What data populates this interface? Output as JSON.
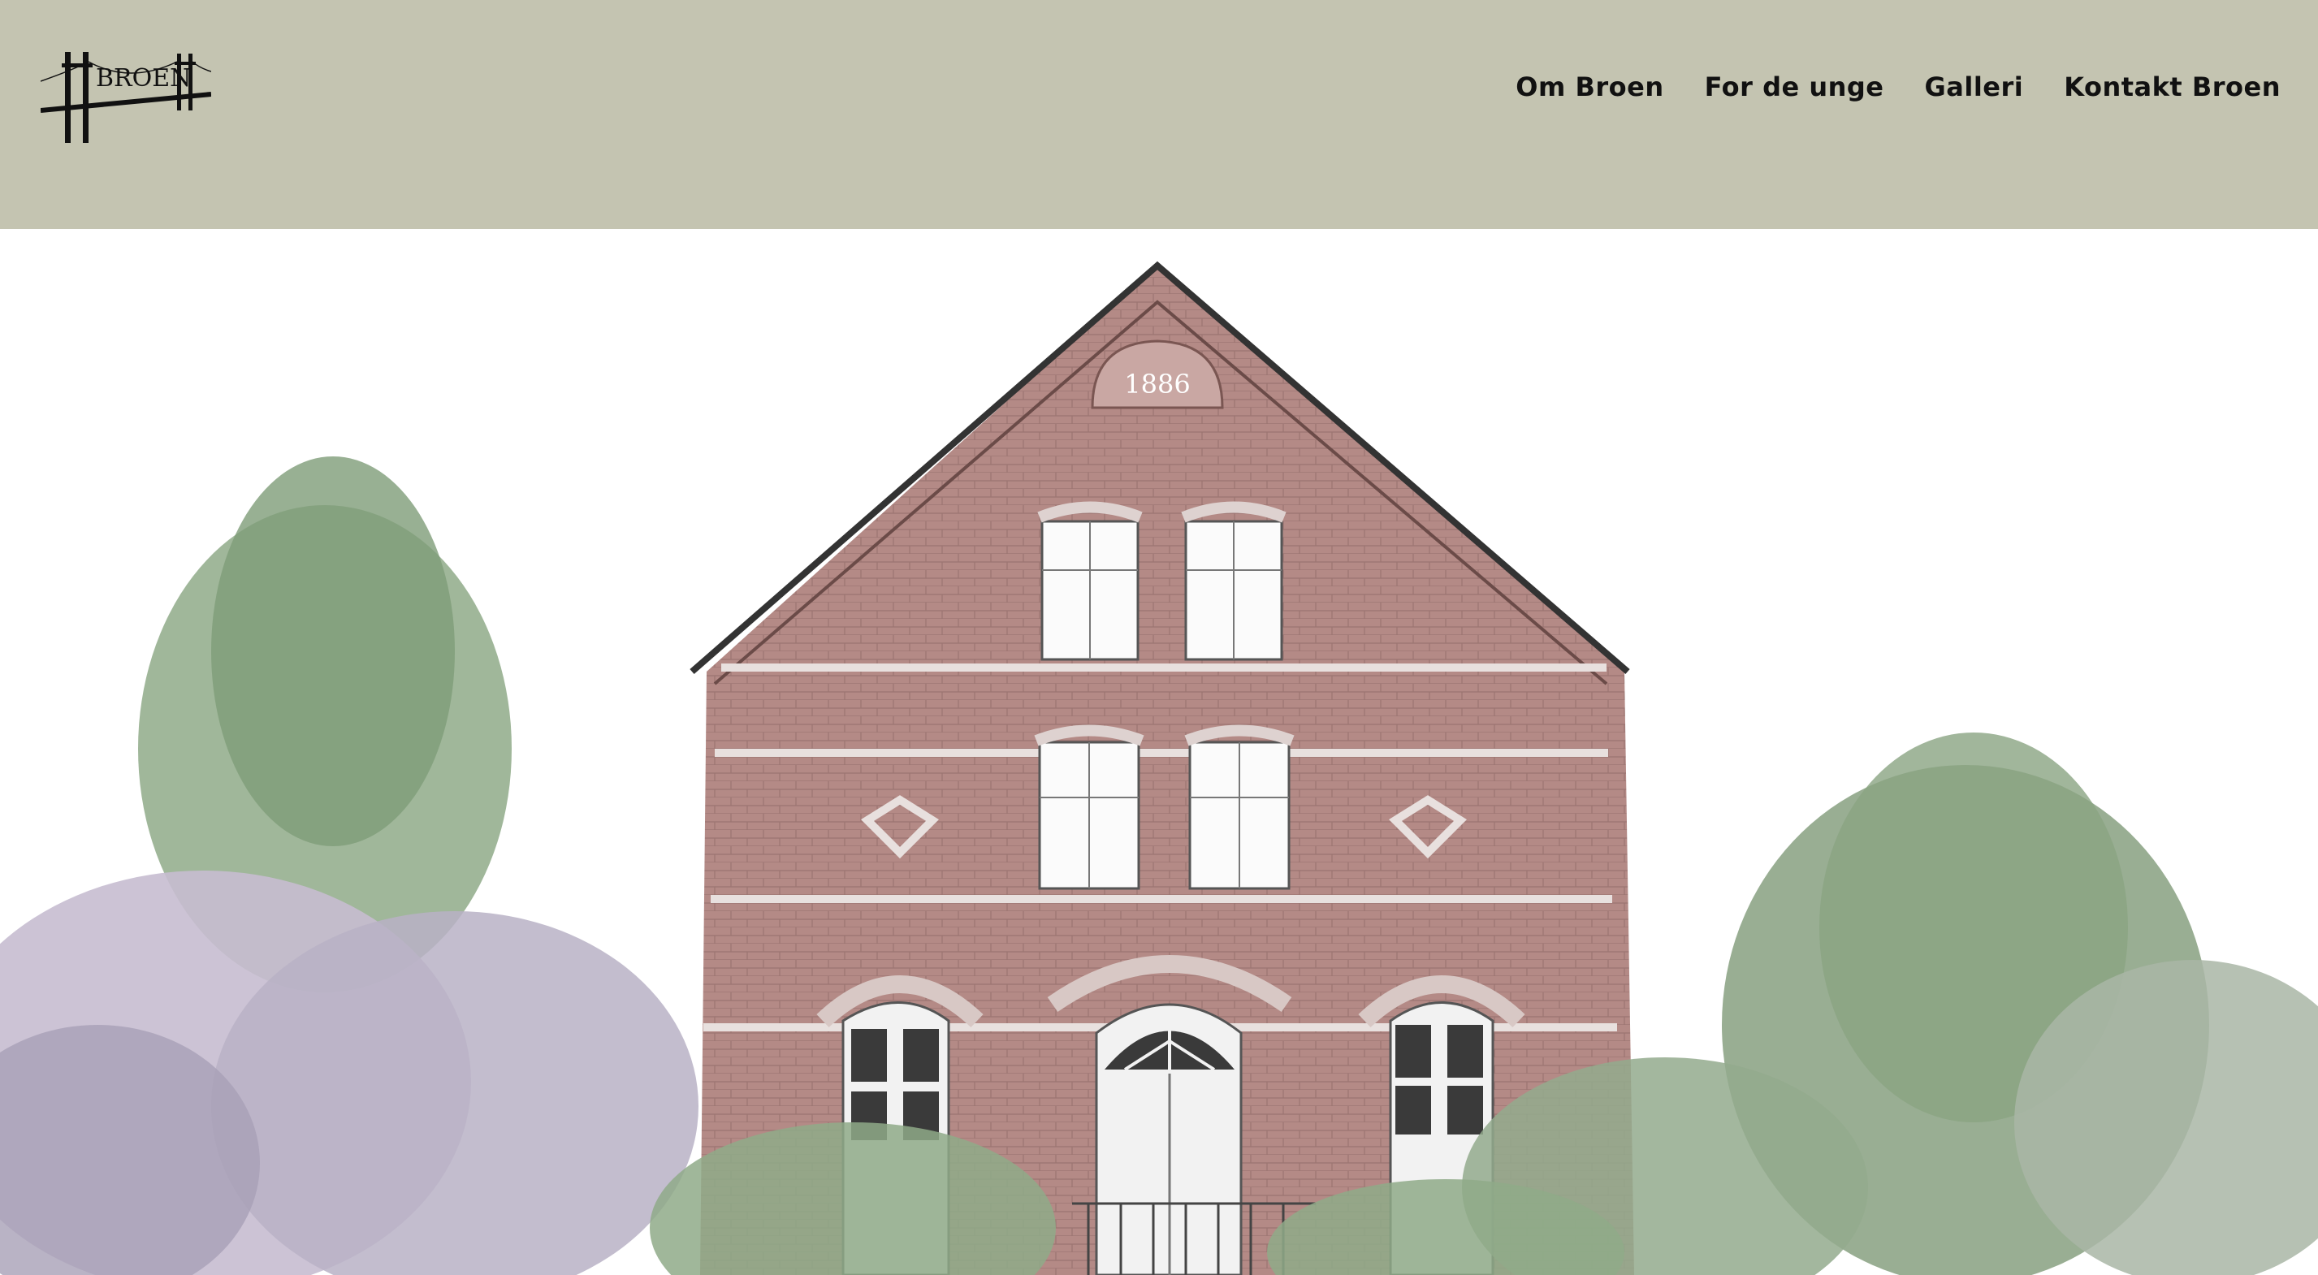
{
  "header": {
    "logo_alt": "Broen logo",
    "logo_text": "BROEN",
    "bg_color": "#c4c4b1"
  },
  "nav": {
    "items": [
      {
        "label": "Om Broen"
      },
      {
        "label": "For de unge"
      },
      {
        "label": "Galleri"
      },
      {
        "label": "Kontakt Broen"
      }
    ]
  },
  "hero": {
    "image_alt": "Old brick building with trees",
    "year_plaque": "1886",
    "brick_color": "#b48a86",
    "foliage_color": "#7f9a78"
  }
}
